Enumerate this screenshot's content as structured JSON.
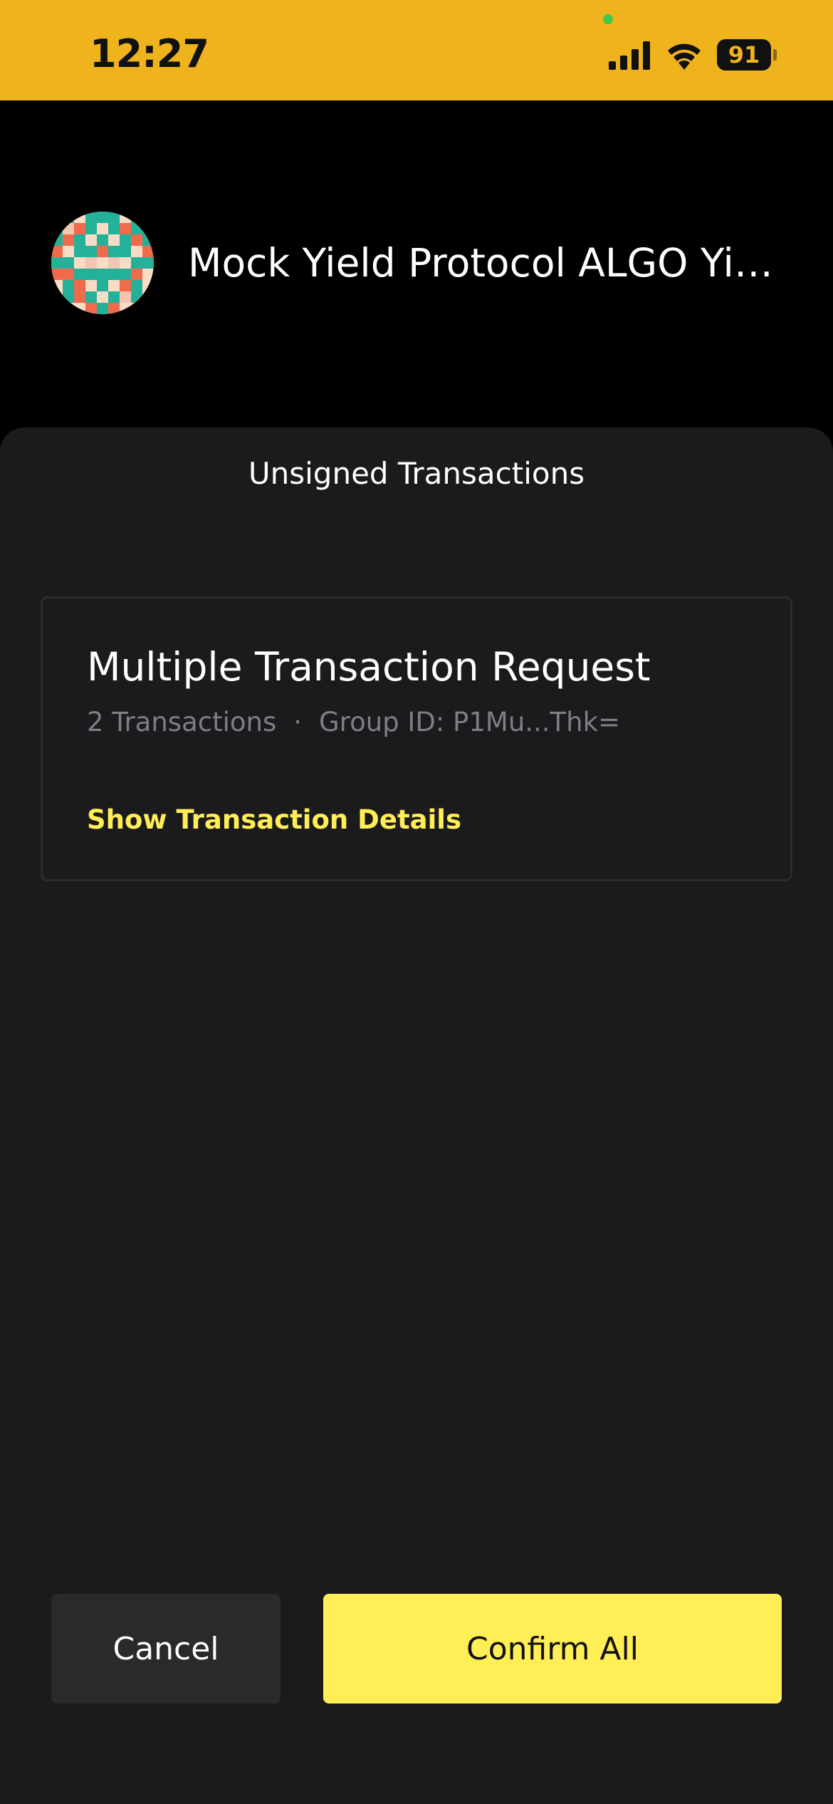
{
  "status_bar": {
    "time": "12:27",
    "battery": "91",
    "icons": [
      "signal-icon",
      "wifi-icon",
      "battery-icon"
    ],
    "background_color": "#EFB31E"
  },
  "header": {
    "title": "Mock Yield Protocol ALGO Yield",
    "avatar": "identicon-avatar"
  },
  "sheet": {
    "title": "Unsigned Transactions",
    "request": {
      "title": "Multiple Transaction Request",
      "count_label": "2 Transactions",
      "separator": "·",
      "group_id_label": "Group ID: P1Mu...Thk=",
      "details_link": "Show Transaction Details"
    },
    "buttons": {
      "cancel": "Cancel",
      "confirm": "Confirm All"
    }
  },
  "colors": {
    "accent": "#FFEE55",
    "sheet_bg": "#1B1B1D",
    "muted_text": "#7E7E84"
  }
}
